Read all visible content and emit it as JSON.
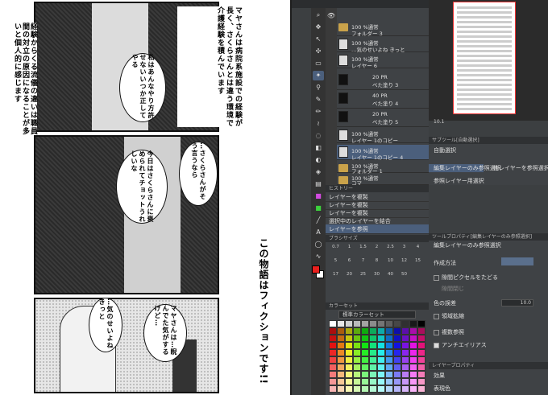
{
  "manga": {
    "narration_1": "マヤさんは病院系施設での経験が長く、さくらさんとは違う環境で介護経験を積んでいます",
    "narration_2": "経験からくる流儀の違いは職員間の対立の原因になることが多いと個人的に感じます",
    "bubble_1": "私はあんなやり方許せないいつか正してやる",
    "bubble_2": "…さくらさんがそう言うなら",
    "bubble_3": "今日はさくらさんに褒められてチョットうれしいな",
    "bubble_4": "…気のせいよねきっと",
    "bubble_5": "マヤさんは…睨んでた気がするけど…",
    "disclaimer": "この物語はフィクションです!!"
  },
  "app": {
    "layers": [
      {
        "title": "100 %通常",
        "name": "フォルダー 3",
        "kind": "folder"
      },
      {
        "title": "100 %通常",
        "name": "…気のせいよね きっと",
        "kind": "text"
      },
      {
        "title": "100 %通常",
        "name": "レイヤー 6",
        "kind": "raster"
      },
      {
        "title": "40 %通常",
        "name": "ベた塗り 3",
        "kind": "fill",
        "pct": "20 PR"
      },
      {
        "title": "50 %通常",
        "name": "ベた塗り 4",
        "kind": "fill",
        "pct": "40 PR"
      },
      {
        "title": "50 %通常",
        "name": "ベた塗り 5",
        "kind": "fill",
        "pct": "20 PR"
      },
      {
        "title": "100 %通常",
        "name": "レイヤー 1のコピー",
        "kind": "raster"
      },
      {
        "title": "100 %通常",
        "name": "レイヤー 1のコピー 4",
        "kind": "raster",
        "selected": true
      },
      {
        "title": "100 %通常",
        "name": "フォルダー 1",
        "kind": "folder"
      },
      {
        "title": "100 %通常",
        "name": "コマ",
        "kind": "folder"
      }
    ],
    "history_header": "ヒストリー",
    "history": [
      "レイヤーを複製",
      "レイヤーを複製",
      "レイヤーを複製",
      "選択中のレイヤーを結合",
      "レイヤーを参照"
    ],
    "brush_header": "ブラシサイズ",
    "brush_sizes": [
      "0.7",
      "1",
      "1.5",
      "2",
      "2.5",
      "3",
      "4",
      "5",
      "6",
      "7",
      "8",
      "10",
      "12",
      "15",
      "17",
      "20",
      "25",
      "30",
      "40",
      "50"
    ],
    "colorset_header": "カラーセット",
    "colorset_name": "標準カラーセット",
    "subtool_header": "サブツール[自動選択]",
    "subtool_items": [
      "自動選択",
      "編集レイヤーのみ参照選択",
      "他レイヤーを参照選択",
      "参照レイヤー用選択"
    ],
    "toolprop_header": "ツールプロパティ[編集レイヤーのみ参照選択]",
    "toolprop_title": "編集レイヤーのみ参照選択",
    "toolprop": {
      "method": "作成方法",
      "close_gaps": "隙間ピクセルをたどる",
      "gap_size": "隙間閉じ",
      "color_margin": "色の誤差",
      "color_margin_value": "10.0",
      "expand": "領域拡縮",
      "ref": "複数参照",
      "antialias": "アンチエイリアス"
    },
    "layerprop_header": "レイヤープロパティ",
    "layerprop_effect": "効果",
    "layerprop_color": "表現色",
    "zoom": "10.1",
    "colors": {
      "main": "#e8201e",
      "sub": "#ffffff"
    }
  }
}
